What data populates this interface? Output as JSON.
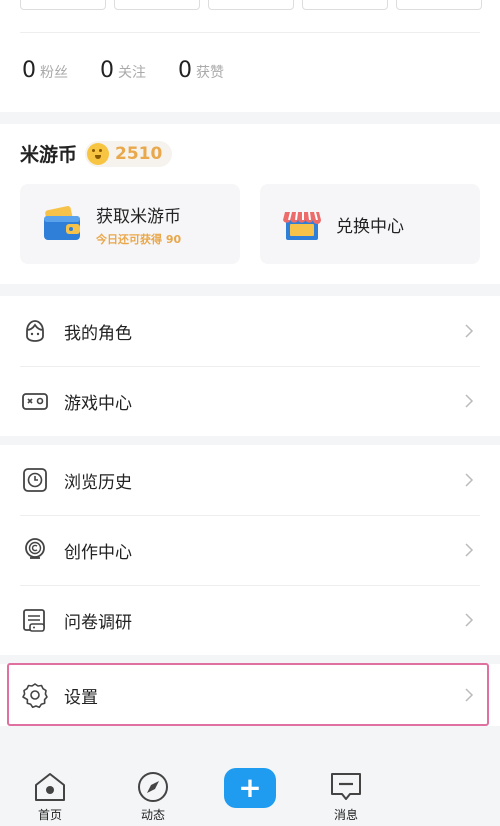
{
  "profile": {
    "stats": [
      {
        "value": "0",
        "label": "粉丝"
      },
      {
        "value": "0",
        "label": "关注"
      },
      {
        "value": "0",
        "label": "获赞"
      }
    ]
  },
  "coins": {
    "title": "米游币",
    "amount": "2510",
    "earn": {
      "title": "获取米游币",
      "subtitle": "今日还可获得 90",
      "icon": "wallet-icon"
    },
    "exchange": {
      "title": "兑换中心",
      "icon": "shop-icon"
    }
  },
  "menu_group_1": [
    {
      "label": "我的角色",
      "icon": "character-icon"
    },
    {
      "label": "游戏中心",
      "icon": "gamepad-icon"
    }
  ],
  "menu_group_2": [
    {
      "label": "浏览历史",
      "icon": "clock-icon"
    },
    {
      "label": "创作中心",
      "icon": "copyright-icon"
    },
    {
      "label": "问卷调研",
      "icon": "survey-icon"
    }
  ],
  "menu_group_3": [
    {
      "label": "设置",
      "icon": "gear-icon"
    }
  ],
  "tabbar": {
    "home": "首页",
    "feed": "动态",
    "post": "+",
    "messages": "消息"
  },
  "colors": {
    "accent": "#1f9cf0",
    "coin": "#e8a84b",
    "highlight": "#e070a0"
  }
}
